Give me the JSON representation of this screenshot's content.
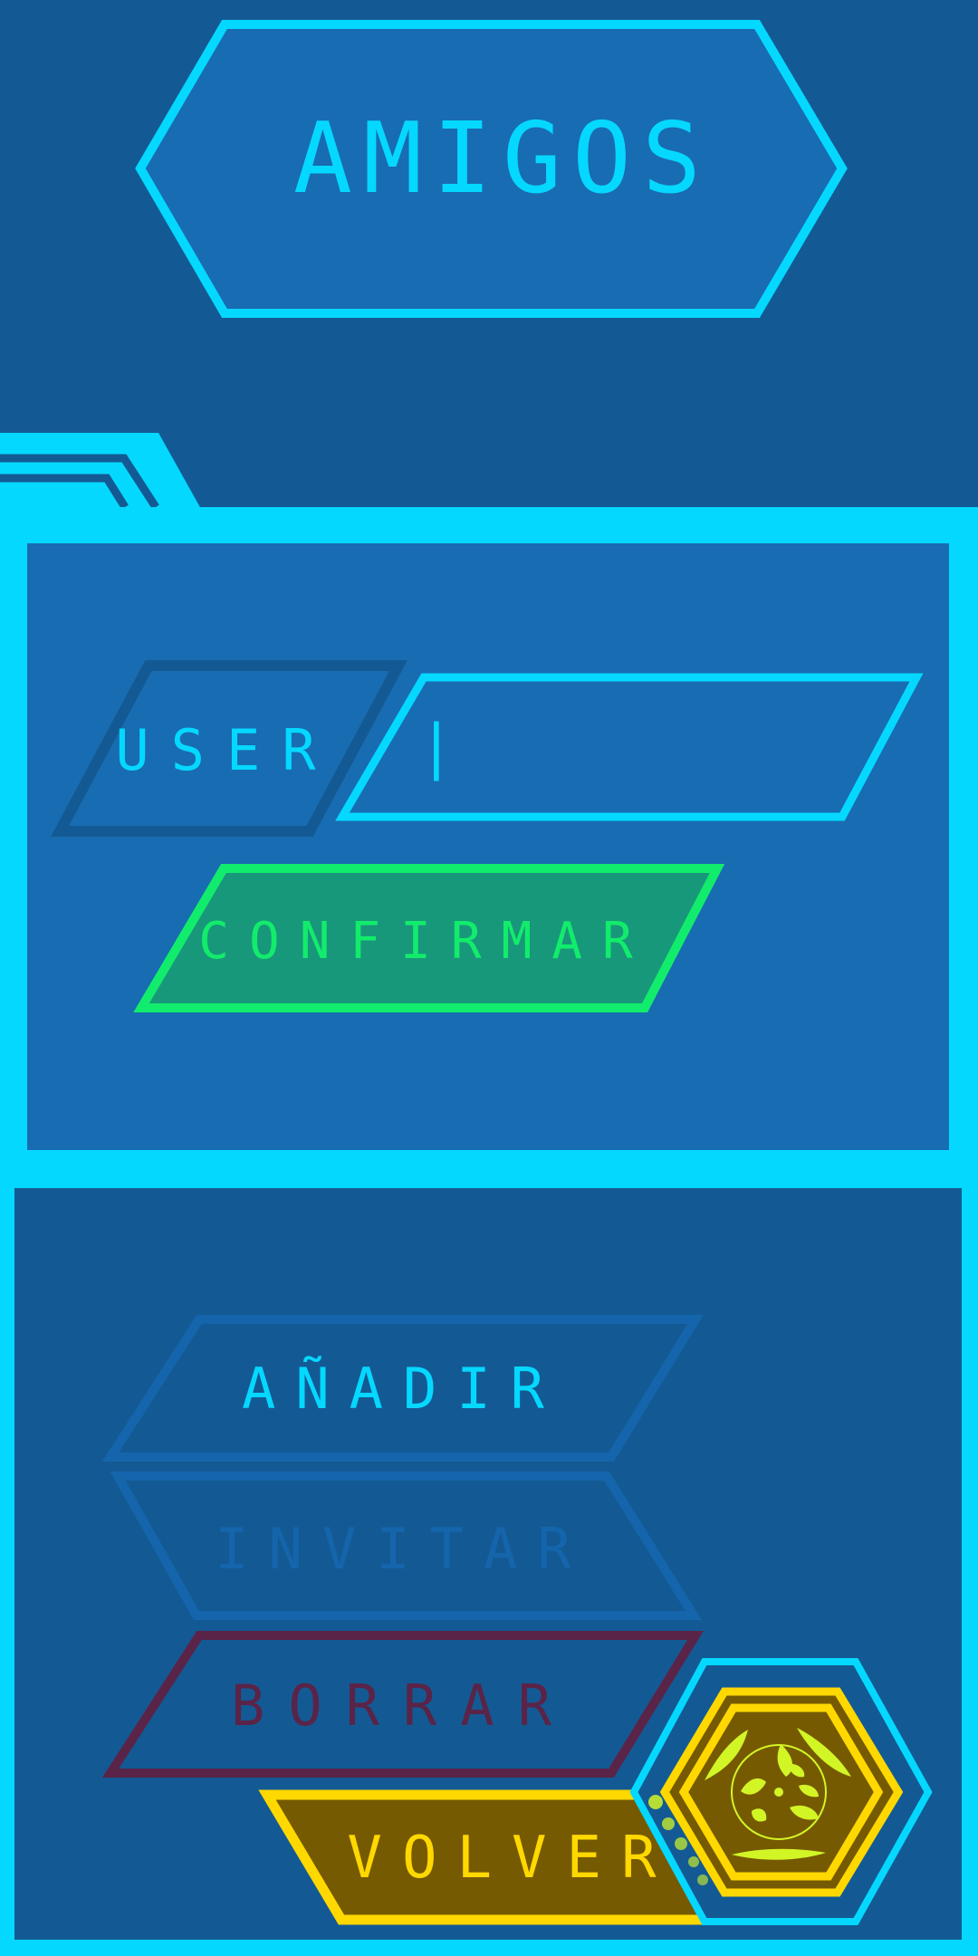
{
  "title": "AMIGOS",
  "form": {
    "user_label": "USER",
    "user_value": "",
    "caret": "|",
    "confirm_label": "CONFIRMAR"
  },
  "actions": {
    "add_label": "AÑADIR",
    "invite_label": "INVITAR",
    "delete_label": "BORRAR",
    "back_label": "VOLVER"
  },
  "states": {
    "add_enabled": true,
    "invite_enabled": false,
    "delete_enabled": false
  },
  "colors": {
    "background": "#135a94",
    "panel": "#186cb2",
    "cyan": "#05d8ff",
    "green": "#12ec6c",
    "green_fill": "#18987a",
    "disabled_blue": "#1565ac",
    "disabled_red": "#5a2448",
    "gold": "#ffd800",
    "gold_fill": "#765a02",
    "lime": "#d2f526"
  },
  "icons": {
    "emblem": "hexagon-seal-icon"
  }
}
